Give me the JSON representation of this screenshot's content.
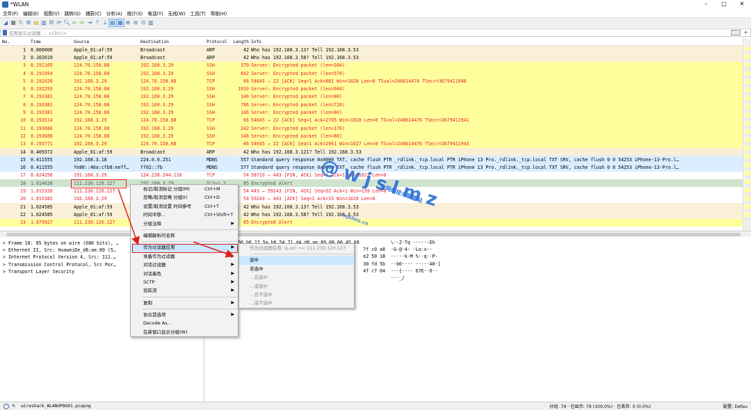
{
  "window": {
    "title": "*WLAN",
    "controls": [
      "–",
      "□",
      "✕"
    ]
  },
  "menubar": [
    "文件(F)",
    "编辑(E)",
    "视图(V)",
    "跳转(G)",
    "捕获(C)",
    "分析(A)",
    "统计(S)",
    "电话(Y)",
    "无线(W)",
    "工具(T)",
    "帮助(H)"
  ],
  "filter": {
    "placeholder": "应用显示过滤器 … <Ctrl-/>"
  },
  "columns": [
    "No.",
    "Time",
    "Source",
    "Destination",
    "Protocol",
    "Length",
    "Info"
  ],
  "packets": [
    [
      "1",
      "0.000000",
      "Apple_01:af:59",
      "Broadcast",
      "ARP",
      "42",
      "Who has 192.168.3.13? Tell 192.168.3.53",
      "arp"
    ],
    [
      "2",
      "0.102019",
      "Apple_01:af:59",
      "Broadcast",
      "ARP",
      "42",
      "Who has 192.168.3.58? Tell 192.168.3.53",
      "arp"
    ],
    [
      "3",
      "0.191165",
      "124.70.158.88",
      "192.168.3.29",
      "SSH",
      "370",
      "Server: Encrypted packet (len=304)",
      "ssh"
    ],
    [
      "4",
      "0.191954",
      "124.70.158.88",
      "192.168.3.29",
      "SSH",
      "642",
      "Server: Encrypted packet (len=576)",
      "ssh"
    ],
    [
      "5",
      "0.192026",
      "192.168.3.29",
      "124.70.158.88",
      "TCP",
      "66",
      "54645 → 22 [ACK] Seq=1 Ack=881 Win=1028 Len=0 TSval=248614474 TSecr=3679411940",
      "tcpbad"
    ],
    [
      "6",
      "0.192293",
      "124.70.158.88",
      "192.168.3.29",
      "SSH",
      "1010",
      "Server: Encrypted packet (len=944)",
      "ssh"
    ],
    [
      "7",
      "0.193381",
      "124.70.158.88",
      "192.168.3.29",
      "SSH",
      "146",
      "Server: Encrypted packet (len=80)",
      "ssh"
    ],
    [
      "8",
      "0.193381",
      "124.70.158.88",
      "192.168.3.29",
      "SSH",
      "786",
      "Server: Encrypted packet (len=720)",
      "ssh"
    ],
    [
      "9",
      "0.193381",
      "124.70.158.88",
      "192.168.3.29",
      "SSH",
      "146",
      "Server: Encrypted packet (len=80)",
      "ssh"
    ],
    [
      "10",
      "0.193514",
      "192.168.3.29",
      "124.70.158.88",
      "TCP",
      "66",
      "54645 → 22 [ACK] Seq=1 Ack=2705 Win=1028 Len=0 TSval=248614476 TSecr=3679411941",
      "tcpbad"
    ],
    [
      "11",
      "0.193686",
      "124.70.158.88",
      "192.168.3.29",
      "SSH",
      "242",
      "Server: Encrypted packet (len=176)",
      "ssh"
    ],
    [
      "12",
      "0.193686",
      "124.70.158.88",
      "192.168.3.29",
      "SSH",
      "146",
      "Server: Encrypted packet (len=80)",
      "ssh"
    ],
    [
      "13",
      "0.193771",
      "192.168.3.29",
      "124.70.158.88",
      "TCP",
      "66",
      "54645 → 22 [ACK] Seq=1 Ack=2961 Win=1027 Len=0 TSval=248614476 TSecr=3679411943",
      "tcpbad"
    ],
    [
      "14",
      "0.409372",
      "Apple_01:af:59",
      "Broadcast",
      "ARP",
      "42",
      "Who has 192.168.3.121? Tell 192.168.3.53",
      "arp"
    ],
    [
      "15",
      "0.411555",
      "192.168.3.18",
      "224.0.0.251",
      "MDNS",
      "557",
      "Standard query response 0x0000 TXT, cache flush PTR _rdlink._tcp.local PTR iPhone 13 Pro._rdlink._tcp.local TXT SRV, cache flush 0 0 54253 iPhone-13-Pro.l…",
      "mdns"
    ],
    [
      "16",
      "0.411555",
      "fe80::40a:cfb8:eeff…",
      "ff02::fb",
      "MDNS",
      "577",
      "Standard query response 0x0000 TXT, cache flush PTR _rdlink._tcp.local PTR iPhone 13 Pro._rdlink._tcp.local TXT SRV, cache flush 0 0 54253 iPhone-13-Pro.l…",
      "mdns"
    ],
    [
      "17",
      "0.624256",
      "192.168.3.29",
      "124.238.244.116",
      "TCP",
      "54",
      "58719 → 443 [FIN, ACK] Seq=1 Ack=1 Win=1023 Len=0",
      "tcp2"
    ],
    [
      "18",
      "1.014620",
      "111.230.120.127",
      "192.168.3.29",
      "TLSv1.2",
      "85",
      "Encrypted Alert",
      "sel"
    ],
    [
      "19",
      "1.015320",
      "111.230.120.127",
      "192.168.3.29",
      "TCP",
      "54",
      "443 → 59243 [FIN, ACK] Seq=32 Ack=1 Win=139 Len=0",
      "tcp2"
    ],
    [
      "20",
      "1.015382",
      "192.168.3.29",
      "111.230.120.127",
      "TCP",
      "54",
      "59243 → 443 [ACK] Seq=1 Ack=33 Win=1020 Len=0",
      "tcp2"
    ],
    [
      "21",
      "1.024585",
      "Apple_01:af:59",
      "Broadcast",
      "ARP",
      "42",
      "Who has 192.168.3.13? Tell 192.168.3.53",
      "arp"
    ],
    [
      "22",
      "1.024585",
      "Apple_01:af:59",
      "Broadcast",
      "ARP",
      "42",
      "Who has 192.168.3.58? Tell 192.168.3.53",
      "arp"
    ],
    [
      "23",
      "1.079927",
      "111.230.120.127",
      "192.168.3.29",
      "TLSv1.2",
      "85",
      "Encrypted Alert",
      "ssh"
    ]
  ],
  "details": [
    "Frame 18: 85 bytes on wire (680 bits), …",
    "Ethernet II, Src: HuaweiDe_d8:ae:89 (5…",
    "Internet Protocol Version 4, Src: 111.…",
    "Transmission Control Protocol, Src Por…",
    "Transport Layer Security"
  ],
  "bytes": [
    [
      "00 b6 12 5a b6 54 71 d4 d8 ae 89 08 00 45 68",
      "\\··Z·Tq ······Eh"
    ],
    [
      "7f c0 a8",
      "·G·@·4· ·Lo·x··"
    ],
    [
      "e2 50 18",
      "·····k·M %··q··P·"
    ],
    [
      "30 fd 5b",
      "··b0···· ·····A0·["
    ],
    [
      "4f c7 04",
      "···{···· 67E··O··"
    ],
    [
      "",
      "···_/"
    ]
  ],
  "context_menu": [
    {
      "label": "标记/取消标记 分组(M)",
      "shortcut": "Ctrl+M"
    },
    {
      "label": "忽略/取消忽略 分组(I)",
      "shortcut": "Ctrl+D"
    },
    {
      "label": "设置/取消设置 时间参考",
      "shortcut": "Ctrl+T"
    },
    {
      "label": "时间平移…",
      "shortcut": "Ctrl+Shift+T"
    },
    {
      "label": "分组注释",
      "shortcut": "",
      "sub": true
    },
    {
      "sep": true
    },
    {
      "label": "编辑解析的名称",
      "shortcut": ""
    },
    {
      "sep": true
    },
    {
      "label": "作为过滤器应用",
      "shortcut": "",
      "sub": true,
      "hl": true
    },
    {
      "label": "准备作为过滤器",
      "shortcut": "",
      "sub": true
    },
    {
      "label": "对话过滤器",
      "shortcut": "",
      "sub": true
    },
    {
      "label": "对话着色",
      "shortcut": "",
      "sub": true
    },
    {
      "label": "SCTP",
      "shortcut": "",
      "sub": true
    },
    {
      "label": "追踪流",
      "shortcut": "",
      "sub": true
    },
    {
      "sep": true
    },
    {
      "label": "复制",
      "shortcut": "",
      "sub": true
    },
    {
      "sep": true
    },
    {
      "label": "协议首选项",
      "shortcut": "",
      "sub": true
    },
    {
      "label": "Decode As…",
      "shortcut": ""
    },
    {
      "label": "在新窗口显示分组(W)",
      "shortcut": ""
    }
  ],
  "submenu": {
    "header": "作为过滤器应用: ip.src == 111.230.120.127",
    "items": [
      {
        "label": "选中",
        "hl": true
      },
      {
        "label": "非选中"
      },
      {
        "label": "…且选中",
        "dis": true
      },
      {
        "label": "…或选中",
        "dis": true
      },
      {
        "label": "…且不选中",
        "dis": true
      },
      {
        "label": "…或不选中",
        "dis": true
      }
    ]
  },
  "status": {
    "file": "wireshark_WLANUP8G01.pcapng",
    "stats": "分组: 79 · 已显示: 79 (100.0%) · 已丢弃: 0 (0.0%)",
    "profile": "配置: Defau"
  },
  "watermark": {
    "handle": "@wjslmz",
    "sub": "@网络技术联盟站",
    "url": "wjslmz.cn"
  },
  "colors": {
    "ssh": "#fffe9c",
    "tcp": "#e7e6ff",
    "arp": "#faf0d7",
    "mdns": "#daeeff",
    "selected": "#cfe3cf",
    "accent": "#e0201a"
  }
}
